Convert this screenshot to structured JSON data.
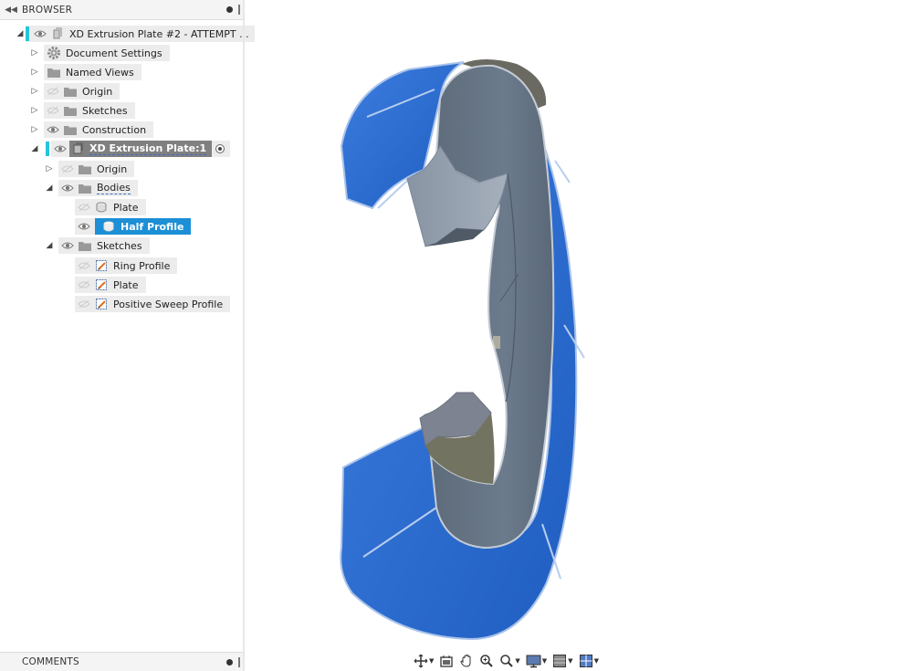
{
  "browser": {
    "title": "BROWSER",
    "tree": {
      "root": "XD Extrusion Plate #2 - ATTEMPT ...",
      "document_settings": "Document Settings",
      "named_views": "Named Views",
      "origin": "Origin",
      "sketches": "Sketches",
      "construction": "Construction",
      "component": "XD Extrusion Plate:1",
      "component_origin": "Origin",
      "bodies": "Bodies",
      "body_plate": "Plate",
      "body_half_profile": "Half Profile",
      "component_sketches": "Sketches",
      "sketch_ring_profile": "Ring Profile",
      "sketch_plate": "Plate",
      "sketch_positive_sweep": "Positive Sweep Profile"
    }
  },
  "comments": {
    "title": "COMMENTS"
  },
  "colors": {
    "accent": "#27c4d9",
    "selection": "#1c8fd6",
    "model_blue": "#2f6fd0",
    "model_grey": "#6b7b8c"
  },
  "toolbar": {
    "icons": [
      "orbit-icon",
      "look-at-icon",
      "pan-icon",
      "zoom-icon",
      "zoom-window-icon",
      "display-settings-icon",
      "grid-settings-icon",
      "viewports-icon"
    ]
  }
}
